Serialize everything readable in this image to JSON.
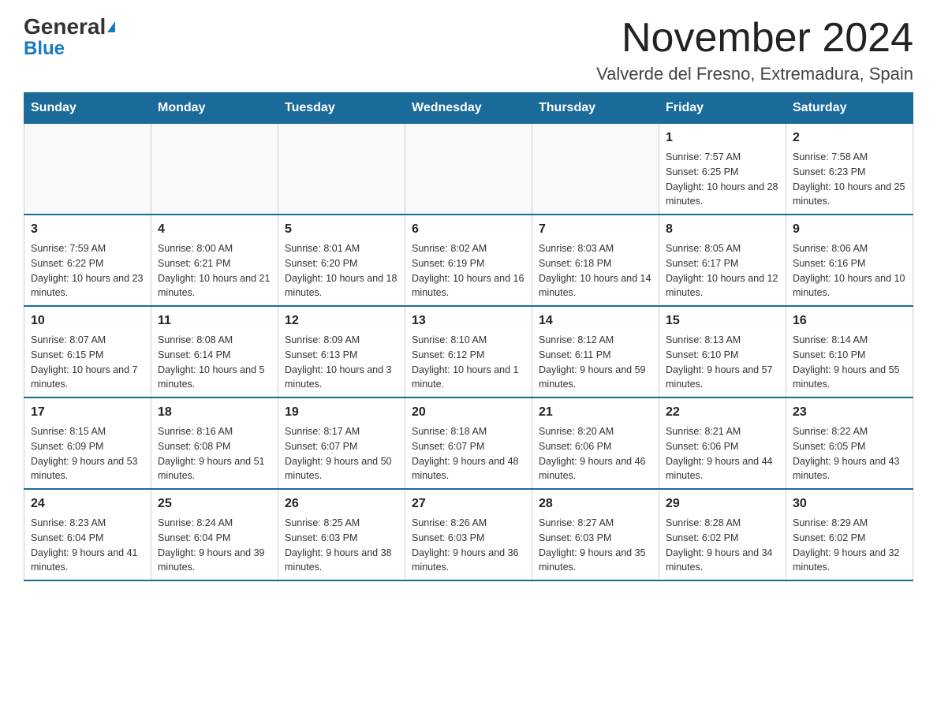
{
  "logo": {
    "text1": "General",
    "text2": "Blue"
  },
  "title": "November 2024",
  "subtitle": "Valverde del Fresno, Extremadura, Spain",
  "days_of_week": [
    "Sunday",
    "Monday",
    "Tuesday",
    "Wednesday",
    "Thursday",
    "Friday",
    "Saturday"
  ],
  "weeks": [
    [
      {
        "day": "",
        "info": ""
      },
      {
        "day": "",
        "info": ""
      },
      {
        "day": "",
        "info": ""
      },
      {
        "day": "",
        "info": ""
      },
      {
        "day": "",
        "info": ""
      },
      {
        "day": "1",
        "info": "Sunrise: 7:57 AM\nSunset: 6:25 PM\nDaylight: 10 hours and 28 minutes."
      },
      {
        "day": "2",
        "info": "Sunrise: 7:58 AM\nSunset: 6:23 PM\nDaylight: 10 hours and 25 minutes."
      }
    ],
    [
      {
        "day": "3",
        "info": "Sunrise: 7:59 AM\nSunset: 6:22 PM\nDaylight: 10 hours and 23 minutes."
      },
      {
        "day": "4",
        "info": "Sunrise: 8:00 AM\nSunset: 6:21 PM\nDaylight: 10 hours and 21 minutes."
      },
      {
        "day": "5",
        "info": "Sunrise: 8:01 AM\nSunset: 6:20 PM\nDaylight: 10 hours and 18 minutes."
      },
      {
        "day": "6",
        "info": "Sunrise: 8:02 AM\nSunset: 6:19 PM\nDaylight: 10 hours and 16 minutes."
      },
      {
        "day": "7",
        "info": "Sunrise: 8:03 AM\nSunset: 6:18 PM\nDaylight: 10 hours and 14 minutes."
      },
      {
        "day": "8",
        "info": "Sunrise: 8:05 AM\nSunset: 6:17 PM\nDaylight: 10 hours and 12 minutes."
      },
      {
        "day": "9",
        "info": "Sunrise: 8:06 AM\nSunset: 6:16 PM\nDaylight: 10 hours and 10 minutes."
      }
    ],
    [
      {
        "day": "10",
        "info": "Sunrise: 8:07 AM\nSunset: 6:15 PM\nDaylight: 10 hours and 7 minutes."
      },
      {
        "day": "11",
        "info": "Sunrise: 8:08 AM\nSunset: 6:14 PM\nDaylight: 10 hours and 5 minutes."
      },
      {
        "day": "12",
        "info": "Sunrise: 8:09 AM\nSunset: 6:13 PM\nDaylight: 10 hours and 3 minutes."
      },
      {
        "day": "13",
        "info": "Sunrise: 8:10 AM\nSunset: 6:12 PM\nDaylight: 10 hours and 1 minute."
      },
      {
        "day": "14",
        "info": "Sunrise: 8:12 AM\nSunset: 6:11 PM\nDaylight: 9 hours and 59 minutes."
      },
      {
        "day": "15",
        "info": "Sunrise: 8:13 AM\nSunset: 6:10 PM\nDaylight: 9 hours and 57 minutes."
      },
      {
        "day": "16",
        "info": "Sunrise: 8:14 AM\nSunset: 6:10 PM\nDaylight: 9 hours and 55 minutes."
      }
    ],
    [
      {
        "day": "17",
        "info": "Sunrise: 8:15 AM\nSunset: 6:09 PM\nDaylight: 9 hours and 53 minutes."
      },
      {
        "day": "18",
        "info": "Sunrise: 8:16 AM\nSunset: 6:08 PM\nDaylight: 9 hours and 51 minutes."
      },
      {
        "day": "19",
        "info": "Sunrise: 8:17 AM\nSunset: 6:07 PM\nDaylight: 9 hours and 50 minutes."
      },
      {
        "day": "20",
        "info": "Sunrise: 8:18 AM\nSunset: 6:07 PM\nDaylight: 9 hours and 48 minutes."
      },
      {
        "day": "21",
        "info": "Sunrise: 8:20 AM\nSunset: 6:06 PM\nDaylight: 9 hours and 46 minutes."
      },
      {
        "day": "22",
        "info": "Sunrise: 8:21 AM\nSunset: 6:06 PM\nDaylight: 9 hours and 44 minutes."
      },
      {
        "day": "23",
        "info": "Sunrise: 8:22 AM\nSunset: 6:05 PM\nDaylight: 9 hours and 43 minutes."
      }
    ],
    [
      {
        "day": "24",
        "info": "Sunrise: 8:23 AM\nSunset: 6:04 PM\nDaylight: 9 hours and 41 minutes."
      },
      {
        "day": "25",
        "info": "Sunrise: 8:24 AM\nSunset: 6:04 PM\nDaylight: 9 hours and 39 minutes."
      },
      {
        "day": "26",
        "info": "Sunrise: 8:25 AM\nSunset: 6:03 PM\nDaylight: 9 hours and 38 minutes."
      },
      {
        "day": "27",
        "info": "Sunrise: 8:26 AM\nSunset: 6:03 PM\nDaylight: 9 hours and 36 minutes."
      },
      {
        "day": "28",
        "info": "Sunrise: 8:27 AM\nSunset: 6:03 PM\nDaylight: 9 hours and 35 minutes."
      },
      {
        "day": "29",
        "info": "Sunrise: 8:28 AM\nSunset: 6:02 PM\nDaylight: 9 hours and 34 minutes."
      },
      {
        "day": "30",
        "info": "Sunrise: 8:29 AM\nSunset: 6:02 PM\nDaylight: 9 hours and 32 minutes."
      }
    ]
  ]
}
